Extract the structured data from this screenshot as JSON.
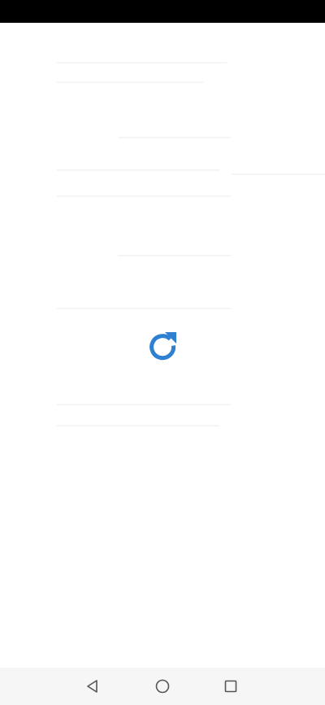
{
  "status_bar": {
    "background": "#000000"
  },
  "content": {
    "state": "loading",
    "spinner_icon": "refresh-icon",
    "spinner_color": "#2f80d1"
  },
  "nav_bar": {
    "background": "#f6f6f6",
    "buttons": [
      "back-triangle-icon",
      "home-circle-icon",
      "recents-square-icon"
    ],
    "icon_color": "#555555"
  }
}
